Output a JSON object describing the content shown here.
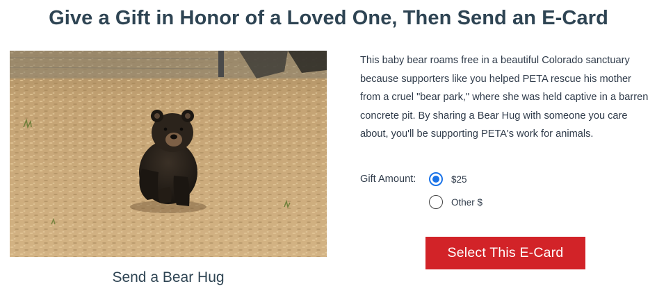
{
  "page": {
    "title": "Give a Gift in Honor of a Loved One, Then Send an E-Card"
  },
  "ecard": {
    "caption": "Send a Bear Hug",
    "description": "This baby bear roams free in a beautiful Colorado sanctuary because supporters like you helped PETA rescue his mother from a cruel \"bear park,\" where she was held captive in a barren concrete pit. By sharing a Bear Hug with someone you care about, you'll be supporting PETA's work for animals.",
    "gift_label": "Gift Amount:",
    "options": [
      {
        "label": "$25",
        "selected": true
      },
      {
        "label": "Other $",
        "selected": false
      }
    ],
    "button_label": "Select This E-Card"
  },
  "colors": {
    "button_bg": "#d22328",
    "radio_accent": "#1a73e8",
    "title_text": "#2e4453"
  },
  "icons": [
    "radio-selected-icon",
    "radio-unselected-icon"
  ]
}
